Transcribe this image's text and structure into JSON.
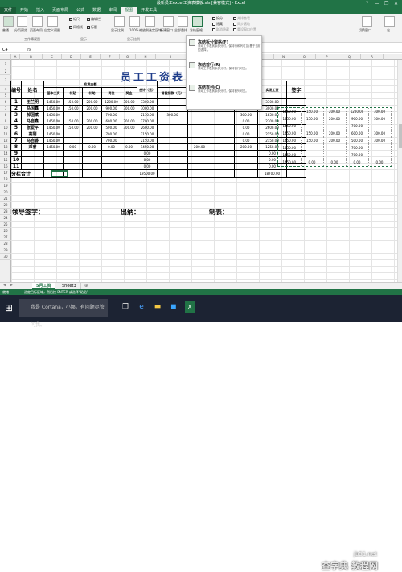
{
  "window": {
    "title": "最新员工excel工资表模板.xls [兼容模式] - Excel",
    "help": "?",
    "minimize": "—",
    "restore": "❐",
    "close": "✕"
  },
  "ribbon_tabs": [
    "文件",
    "开始",
    "插入",
    "页面布局",
    "公式",
    "数据",
    "审阅",
    "视图",
    "开发工具"
  ],
  "ribbon": {
    "workbook_views": {
      "normal": "普通",
      "page_break": "分页预览",
      "page_layout": "页面布局",
      "custom": "自定义视图",
      "group": "工作簿视图"
    },
    "show": {
      "ruler": "标尺",
      "formula_bar": "编辑栏",
      "gridlines": "网格线",
      "headings": "标题",
      "group": "显示"
    },
    "zoom": {
      "zoom": "显示比例",
      "hundred": "100%",
      "to_selection": "缩放到选定区域",
      "group": "显示比例"
    },
    "window_group": {
      "new_window": "新建窗口",
      "arrange_all": "全部重排",
      "freeze": "冻结窗格",
      "split": "拆分",
      "hide": "隐藏",
      "unhide": "取消隐藏",
      "side_by_side": "并排查看",
      "sync_scroll": "同步滚动",
      "reset_pos": "重设窗口位置",
      "switch": "切换窗口",
      "macros": "宏"
    }
  },
  "freeze_menu": {
    "items": [
      {
        "title": "冻结拆分窗格(F)",
        "desc": "滚动工作表其余部分时，保持行和列可见(基于当前的选择)。"
      },
      {
        "title": "冻结首行(R)",
        "desc": "滚动工作表其余部分时，保持首行可见。"
      },
      {
        "title": "冻结首列(C)",
        "desc": "滚动工作表其余部分时，保持首列可见。"
      }
    ]
  },
  "formula_bar": {
    "name_box": "C4",
    "fx": "fx"
  },
  "columns": [
    "A",
    "B",
    "C",
    "D",
    "E",
    "F",
    "G",
    "H",
    "I",
    "J",
    "K",
    "L",
    "M",
    "N",
    "O",
    "P",
    "Q",
    "R"
  ],
  "rows": [
    "1",
    "2",
    "3",
    "4",
    "5",
    "6",
    "7",
    "8",
    "9",
    "10",
    "11",
    "12",
    "13",
    "14",
    "15",
    "16",
    "17",
    "18",
    "19",
    "20",
    "21",
    "22",
    "23",
    "24",
    "25",
    "26",
    "27",
    "28",
    "29",
    "30"
  ],
  "sheet": {
    "title": "员工工资表",
    "info": "发放日期：2017年4月",
    "headers": {
      "num": "编号",
      "name": "姓名",
      "income": "应发金额",
      "deduct": "扣款",
      "basic": "基本工资",
      "allowance": "补贴",
      "bonus": "补助",
      "post": "岗位",
      "award": "奖金",
      "total": "合计（元）",
      "leave": "请假扣款（元）",
      "late": "迟到扣款（元）",
      "other": "其它扣款（元）",
      "ded_total": "扣款合计（元）",
      "net": "实发工资",
      "sign": "签字"
    },
    "rows": [
      {
        "no": "1",
        "name": "王兰明",
        "v": [
          "1450.00",
          "150.00",
          "200.00",
          "1200.00",
          "300.00",
          "3300.00",
          "",
          "",
          "",
          "0.00",
          "3300.00"
        ]
      },
      {
        "no": "2",
        "name": "马国鑫",
        "v": [
          "1450.00",
          "150.00",
          "200.00",
          "900.00",
          "300.00",
          "3000.00",
          "",
          "",
          "",
          "0.00",
          "3000.00"
        ]
      },
      {
        "no": "3",
        "name": "郝国斌",
        "v": [
          "1450.00",
          "",
          "",
          "700.00",
          "",
          "2150.00",
          "300.00",
          "",
          "",
          "300.00",
          "1850.00"
        ]
      },
      {
        "no": "4",
        "name": "马自鑫",
        "v": [
          "1450.00",
          "150.00",
          "200.00",
          "600.00",
          "300.00",
          "2700.00",
          "",
          "",
          "",
          "0.00",
          "2700.00"
        ]
      },
      {
        "no": "5",
        "name": "张爱平",
        "v": [
          "1450.00",
          "150.00",
          "200.00",
          "500.00",
          "300.00",
          "2600.00",
          "",
          "",
          "",
          "0.00",
          "2600.00"
        ]
      },
      {
        "no": "6",
        "name": "高刚",
        "v": [
          "1450.00",
          "",
          "",
          "700.00",
          "",
          "2150.00",
          "",
          "",
          "",
          "0.00",
          "2150.00"
        ]
      },
      {
        "no": "7",
        "name": "马自香",
        "v": [
          "1450.00",
          "",
          "",
          "700.00",
          "",
          "2150.00",
          "",
          "",
          "",
          "0.00",
          "2150.00"
        ]
      },
      {
        "no": "8",
        "name": "邓睿",
        "v": [
          "1450.00",
          "0.00",
          "0.00",
          "0.00",
          "0.00",
          "1450.00",
          "",
          "200.00",
          "",
          "200.00",
          "1250.00"
        ]
      },
      {
        "no": "9",
        "name": "",
        "v": [
          "",
          "",
          "",
          "",
          "",
          "0.00",
          "",
          "",
          "",
          "",
          "0.00"
        ]
      },
      {
        "no": "10",
        "name": "",
        "v": [
          "",
          "",
          "",
          "",
          "",
          "0.00",
          "",
          "",
          "",
          "",
          "0.00"
        ]
      },
      {
        "no": "11",
        "name": "",
        "v": [
          "",
          "",
          "",
          "",
          "",
          "0.00",
          "",
          "",
          "",
          "",
          "0.00"
        ]
      }
    ],
    "sum_label": "分栏合计",
    "sum_total": "19500.00",
    "sum_net": "18700.00",
    "sig_leader": "领导签字：",
    "sig_cashier": "出纳：",
    "sig_maker": "制表："
  },
  "right_copy": [
    [
      "1450.00",
      "150.00",
      "200.00",
      "1200.00",
      "300.00"
    ],
    [
      "1450.00",
      "150.00",
      "200.00",
      "900.00",
      "300.00"
    ],
    [
      "1450.00",
      "",
      "",
      "700.00",
      ""
    ],
    [
      "1450.00",
      "150.00",
      "200.00",
      "600.00",
      "300.00"
    ],
    [
      "1450.00",
      "150.00",
      "200.00",
      "500.00",
      "300.00"
    ],
    [
      "1450.00",
      "",
      "",
      "700.00",
      ""
    ],
    [
      "1450.00",
      "",
      "",
      "700.00",
      ""
    ],
    [
      "1450.00",
      "0.00",
      "0.00",
      "0.00",
      "0.00"
    ]
  ],
  "sheet_tabs": [
    "5月工资",
    "Sheet3",
    "⊕"
  ],
  "status": {
    "left": "就绪",
    "mid": "选定目标区域，然后按 ENTER 或选择“粘贴”"
  },
  "taskbar": {
    "search": "我是 Cortana，小娜。有问题尽管问我。",
    "start": "⊞"
  },
  "watermark": {
    "site": "jb51.net",
    "text": "查字典 教程网"
  }
}
